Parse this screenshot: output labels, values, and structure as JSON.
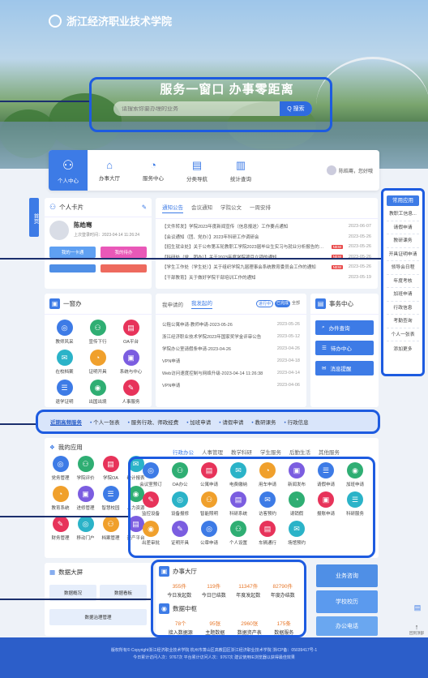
{
  "brand": {
    "logo_text": "浙江经济职业技术学院"
  },
  "hero": {
    "slogan": "服务一窗口  办事零距离",
    "search_placeholder": "请搜索你要办理的业务",
    "search_button": "Q 搜索"
  },
  "nav": {
    "items": [
      {
        "label": "个人中心",
        "icon": "user-icon"
      },
      {
        "label": "办事大厅",
        "icon": "home-icon"
      },
      {
        "label": "服务中心",
        "icon": "service-icon"
      },
      {
        "label": "分类导航",
        "icon": "category-icon"
      },
      {
        "label": "统计查询",
        "icon": "chart-icon"
      }
    ],
    "user_text": "陈皓骞，您好哦"
  },
  "side_tab": "首页",
  "personal": {
    "title": "个人卡片",
    "name": "陈皓骞",
    "last_login": "上次登录时间：2023-04-14 11:26:24",
    "buttons": [
      "我的一卡通",
      "我的待办"
    ]
  },
  "notice": {
    "tabs": [
      "通知公告",
      "会议通知",
      "学院公文",
      "一周安排"
    ],
    "rows": [
      {
        "title": "【文件转发】学院2023年度新闻宣传（信息报送）工作要点通知",
        "tag": "",
        "date": "2023-06-07"
      },
      {
        "title": "【会议通知（团、党办）】2023年科研工作调研会",
        "tag": "",
        "date": "2023-05-26"
      },
      {
        "title": "【招生就业处】关于公布第五轮教职工学院2023届毕业生实习与就业分析报告的通知（规范性文件）",
        "tag": "NEW",
        "date": "2023-05-26"
      },
      {
        "title": "【科研处（党、团办）】关于2023年度学院项目立项的通知",
        "tag": "NEW",
        "date": "2023-05-26"
      },
      {
        "title": "【学生工作处（学生处）】关于组织学院九届理事会系统教育委员会工作的通知",
        "tag": "NEW",
        "date": "2023-05-26"
      },
      {
        "title": "【干部教育】关于做好学院干部培训工作的通知",
        "tag": "",
        "date": "2023-05-19"
      }
    ]
  },
  "one_window": {
    "title": "一窗办",
    "items": [
      "教师风采",
      "宣传下行",
      "OA平台",
      "在校档案",
      "证明开具",
      "系统与中心",
      "退学证明",
      "出国出境",
      "人事服务"
    ]
  },
  "apply": {
    "tabs": [
      "我申请的",
      "我发起的"
    ],
    "filters": [
      "进行中",
      "已完成",
      "全部"
    ],
    "rows": [
      {
        "title": "公租公寓申请-教师申请-2023-05-26",
        "date": "2023-05-26"
      },
      {
        "title": "浙江经济职业技术学院2023年国家奖学金评审公告",
        "date": "2023-05-12"
      },
      {
        "title": "学院办公室请假条申请-2023-04-26",
        "date": "2023-04-26"
      },
      {
        "title": "VPN申请",
        "date": "2023-04-18"
      },
      {
        "title": "Web访问速度控制与网络升级-2023-04-14 11:26:38",
        "date": "2023-04-14"
      },
      {
        "title": "VPN申请",
        "date": "2023-04-06"
      }
    ]
  },
  "affairs": {
    "title": "事务中心",
    "buttons": [
      "办件查询",
      "待办中心",
      "消息提醒"
    ]
  },
  "side_menu": {
    "header": "常用应用",
    "items": [
      "教职工信息...",
      "请假申请",
      "教研课务",
      "开具证明申请",
      "领导会日程",
      "年度考核",
      "加班申请",
      "行政信息",
      "考勤查询",
      "个人一张表"
    ],
    "more": "添加更多"
  },
  "hot": {
    "label": "近期高频服务",
    "items": [
      "个人一张表",
      "服务行政、师政经费",
      "加班申请",
      "请假申请",
      "教研课务",
      "行政信息"
    ]
  },
  "my_apps": {
    "title": "我的应用",
    "left_items": [
      "党务管理",
      "学院评价",
      "学院OA",
      "统计报表",
      "教育系统",
      "进修管理",
      "智慧校园",
      "人力资源",
      "财务管理",
      "移动门户",
      "档案管理",
      "资产平台"
    ],
    "tabs": [
      "行政办公",
      "人事管理",
      "教学科研",
      "学生服务",
      "后勤生活",
      "其他服务"
    ],
    "right_items": [
      "会议室预订",
      "OA办公",
      "公寓申请",
      "电费缴纳",
      "用车申请",
      "新闻发布",
      "请假申请",
      "加班申请",
      "监控设备",
      "设备报修",
      "智能照明",
      "科研系统",
      "访客预约",
      "请销假",
      "报账申请",
      "科研服务",
      "出差审批",
      "证明开具",
      "公章申请",
      "个人设置",
      "车辆通行",
      "场馆预约"
    ]
  },
  "big_data": {
    "title": "数据大屏",
    "buttons": [
      "数据概况",
      "数据看板",
      "数据治理管理"
    ]
  },
  "hall": {
    "title": "办事大厅",
    "stats": [
      {
        "value": "355件",
        "label": "今日发起数"
      },
      {
        "value": "119件",
        "label": "今日已结数"
      },
      {
        "value": "11347件",
        "label": "年度发起数"
      },
      {
        "value": "82790件",
        "label": "年度办结数"
      }
    ]
  },
  "data_center": {
    "title": "数据中枢",
    "stats": [
      {
        "value": "78个",
        "label": "接入数据源"
      },
      {
        "value": "95张",
        "label": "主题数据"
      },
      {
        "value": "2960张",
        "label": "数据资产表"
      },
      {
        "value": "175条",
        "label": "数据服务"
      }
    ]
  },
  "right_buttons": [
    "业务咨询",
    "学校校历",
    "办公电话"
  ],
  "float": {
    "top_label": "回到顶部",
    "feedback": "反馈"
  },
  "footer": {
    "line1": "版权所有© Copyright浙江经济职业技术学院   杭州市萧山区高教园区浙江经济职业技术学院   浙ICP备：05039417号-1",
    "line2": "今日累计访问人次：9767次 平台累计访问人次：9767次  建议使用IE浏览器以获得最佳效果"
  }
}
